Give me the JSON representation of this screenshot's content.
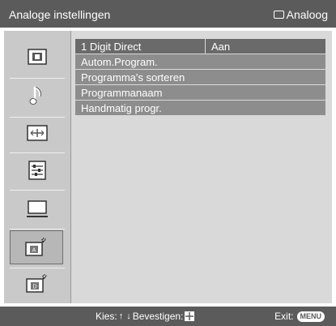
{
  "header": {
    "title": "Analoge instellingen",
    "source_label": "Analoog",
    "source_icon": "tv-screen-icon"
  },
  "sidebar": {
    "items": [
      {
        "icon": "picture-icon",
        "selected": false
      },
      {
        "icon": "sound-note-icon",
        "selected": false
      },
      {
        "icon": "screen-format-icon",
        "selected": false
      },
      {
        "icon": "settings-list-icon",
        "selected": false
      },
      {
        "icon": "pc-monitor-icon",
        "selected": false
      },
      {
        "icon": "analog-antenna-icon",
        "selected": true
      },
      {
        "icon": "digital-antenna-icon",
        "selected": false
      }
    ]
  },
  "menu": {
    "rows": [
      {
        "label": "1 Digit Direct",
        "value": "Aan",
        "selected": true
      },
      {
        "label": "Autom.Program.",
        "value": ""
      },
      {
        "label": "Programma's sorteren",
        "value": ""
      },
      {
        "label": "Programmanaam",
        "value": ""
      },
      {
        "label": "Handmatig progr.",
        "value": ""
      }
    ]
  },
  "footer": {
    "select_text": "Kies:",
    "confirm_text": "Bevestigen:",
    "exit_text": "Exit:",
    "menu_button": "MENU"
  },
  "colors": {
    "bar": "#5b5b5b",
    "panel": "#d9d9d9",
    "row": "#8d8d8d",
    "row_selected": "#6a6a6a"
  }
}
